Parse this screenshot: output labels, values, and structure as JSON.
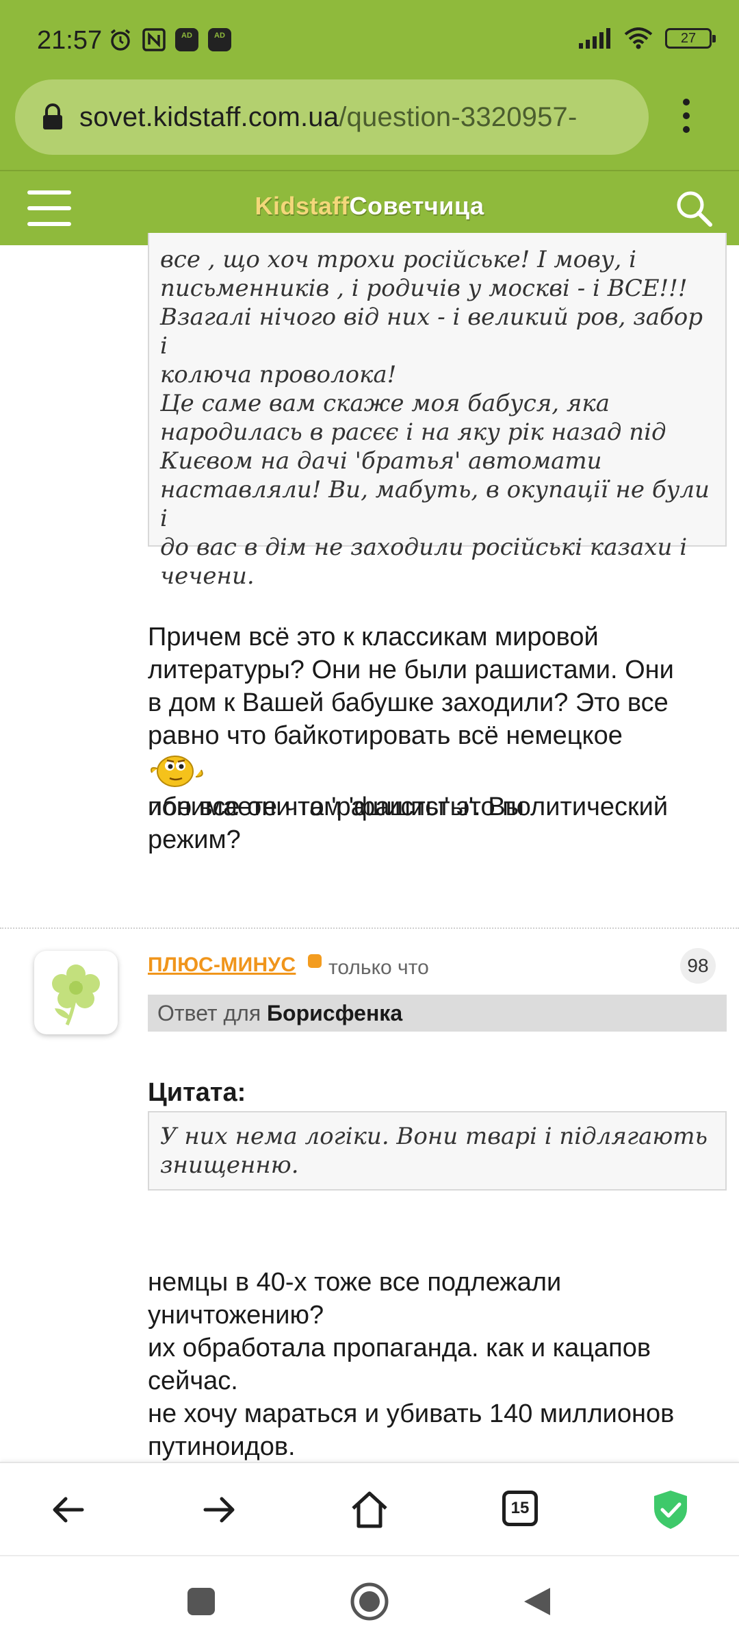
{
  "status_bar": {
    "time": "21:57",
    "battery": "27",
    "left_icons": [
      "alarm-icon",
      "nfc-icon",
      "adblock-icon",
      "adblock-icon"
    ],
    "right_icons": [
      "signal-icon",
      "wifi-icon",
      "battery-icon"
    ],
    "ad_badge_text": "AD"
  },
  "browser": {
    "url_domain": "sovet.kidstaff.com.ua",
    "url_path": "/question-3320957-",
    "tab_count": "15"
  },
  "site_header": {
    "logo_part1": "Kidstaff",
    "logo_part2": "Советчица"
  },
  "prev_post": {
    "quote_text": "все , що хоч трохи російське! І мову, і\nписьменників , і родичів у москві - і ВСЕ!!!\nВзагалі нічого від них - і великий ров, забор і\nколюча проволока!\nЦе саме вам скаже моя бабуся, яка\nнародилась в расєє і на яку рік назад під\nКиєвом на дачі 'братья' автомати\nнаставляли! Ви, мабуть, в окупації не були і\nдо вас в дім не заходили російські казахи і\nчечени.",
    "body_part1": "Причем всё это к классикам мировой\nлитературы? Они не были рашистами. Они\nв дом к Вашей бабушке заходили? Это все\nравно что байкотировать всё немецкое",
    "body_part2": "ибо все они там 'фашисты'. Вы",
    "body_part3": "понимаете что 'рашисты' это политический\nрежим?"
  },
  "post": {
    "author": "ПЛЮС-МИНУС",
    "timestamp": "только что",
    "rating": "98",
    "reply_label": "Ответ для",
    "reply_name": "Борисфенка",
    "quote_label": "Цитата:",
    "quote_text": "У них нема логіки. Вони тварі і підлягають\nзнищенню.",
    "body": "немцы в 40-х тоже все подлежали\nуничтожению?\nих обработала пропаганда. как и кацапов\nсейчас.\nне хочу мараться и убивать 140 миллионов\nпутиноидов."
  },
  "colors": {
    "brand_green": "#8fba3c",
    "author_orange": "#f0951b",
    "shield_green": "#3ec96a"
  }
}
